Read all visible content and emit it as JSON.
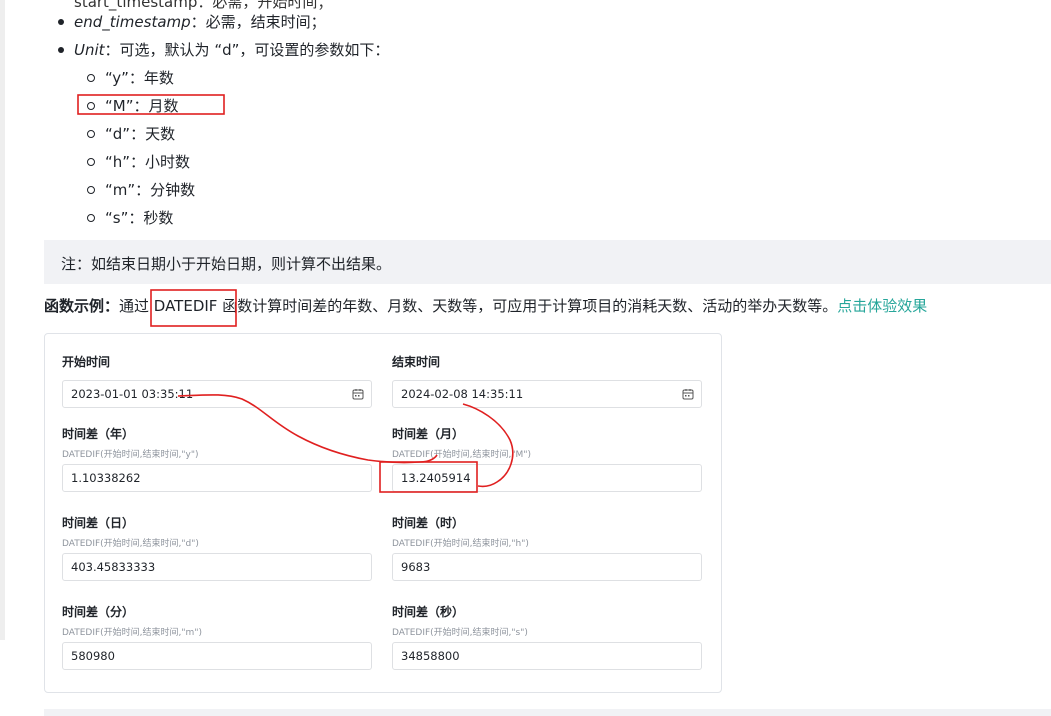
{
  "top_line": "start_timestamp：必需，开始时间；",
  "params": [
    {
      "name": "end_timestamp",
      "desc": "：必需，结束时间；"
    },
    {
      "name": "Unit",
      "desc": "：可选，默认为 “d”，可设置的参数如下："
    }
  ],
  "units": [
    "“y”：年数",
    "“M”：月数",
    "“d”：天数",
    "“h”：小时数",
    "“m”：分钟数",
    "“s”：秒数"
  ],
  "note": "注：如结束日期小于开始日期，则计算不出结果。",
  "example": {
    "label": "函数示例：",
    "text_before": "通过 ",
    "func": "DATEDIF",
    "text_after": " 函数计算时间差的年数、月数、天数等，可应用于计算项目的消耗天数、活动的举办天数等。",
    "link": "点击体验效果"
  },
  "form": {
    "start": {
      "label": "开始时间",
      "value": "2023-01-01 03:35:11"
    },
    "end": {
      "label": "结束时间",
      "value": "2024-02-08 14:35:11"
    },
    "years": {
      "label": "时间差（年）",
      "formula": "DATEDIF(开始时间,结束时间,\"y\")",
      "value": "1.10338262"
    },
    "months": {
      "label": "时间差（月）",
      "formula": "DATEDIF(开始时间,结束时间,\"M\")",
      "value": "13.2405914"
    },
    "days": {
      "label": "时间差（日）",
      "formula": "DATEDIF(开始时间,结束时间,\"d\")",
      "value": "403.45833333"
    },
    "hours": {
      "label": "时间差（时）",
      "formula": "DATEDIF(开始时间,结束时间,\"h\")",
      "value": "9683"
    },
    "minutes": {
      "label": "时间差（分）",
      "formula": "DATEDIF(开始时间,结束时间,\"m\")",
      "value": "580980"
    },
    "seconds": {
      "label": "时间差（秒）",
      "formula": "DATEDIF(开始时间,结束时间,\"s\")",
      "value": "34858800"
    }
  },
  "colors": {
    "annotation": "#e02020",
    "link": "#26a69a",
    "note_bg": "#f1f2f5"
  },
  "icons": {
    "date_picker": "calendar-icon"
  }
}
